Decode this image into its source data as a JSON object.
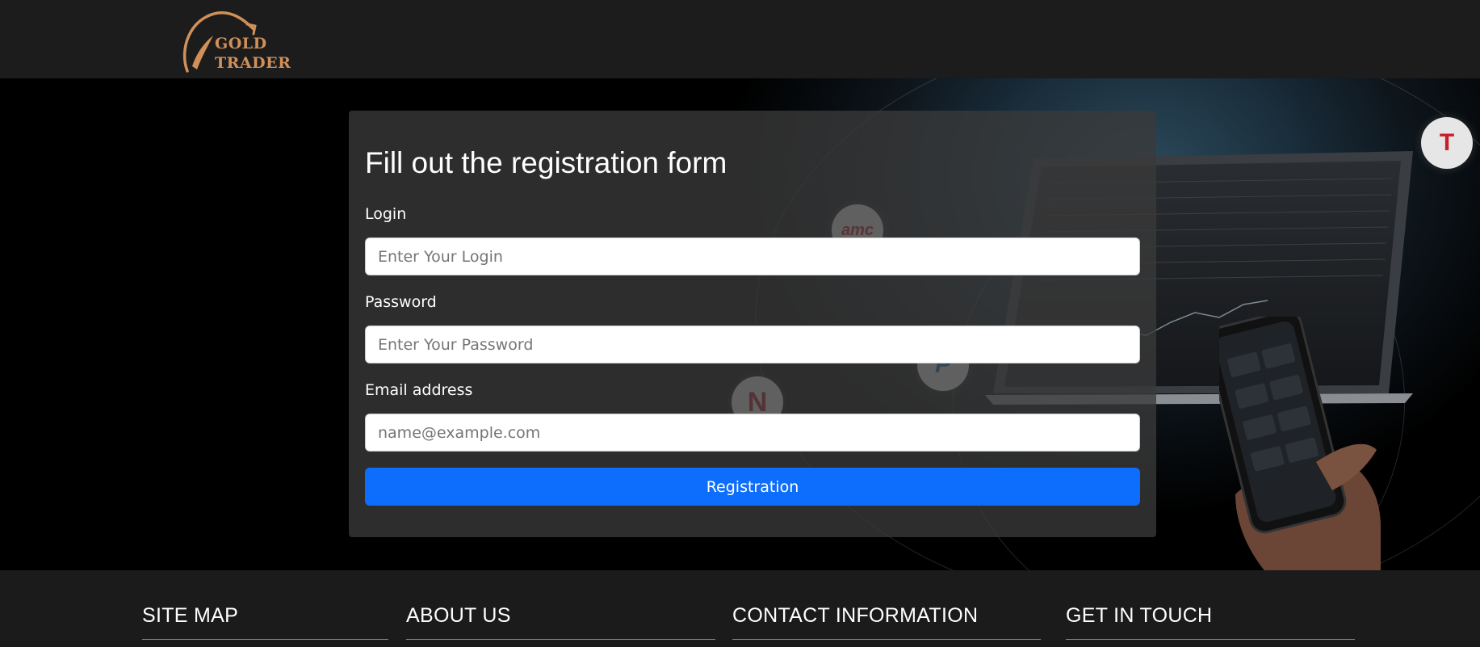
{
  "brand": {
    "logo_line1": "GOLD",
    "logo_line2": "TRADER",
    "logo_color": "#d0905a"
  },
  "form": {
    "title": "Fill out the registration form",
    "login_label": "Login",
    "login_placeholder": "Enter Your Login",
    "password_label": "Password",
    "password_placeholder": "Enter Your Password",
    "email_label": "Email address",
    "email_placeholder": "name@example.com",
    "submit_label": "Registration",
    "submit_color": "#0d6efd"
  },
  "hero_logos": {
    "amc": "amc",
    "netflix": "N",
    "tesla": "T",
    "paypal": "P"
  },
  "footer": {
    "headings": [
      "SITE MAP",
      "ABOUT US",
      "CONTACT INFORMATION",
      "GET IN TOUCH"
    ]
  }
}
